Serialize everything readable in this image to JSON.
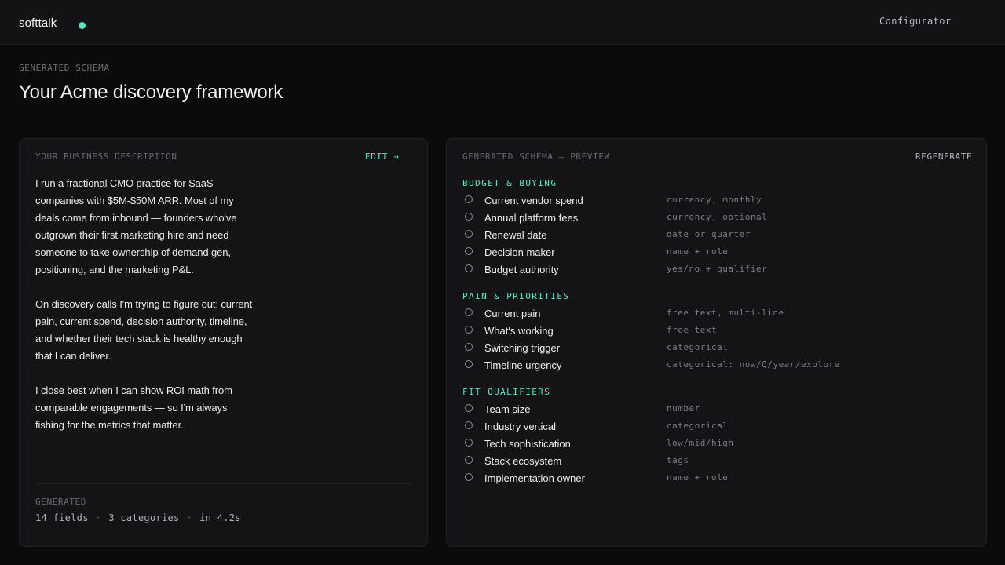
{
  "app": {
    "brand": "softtalk",
    "status_color": "#5ee0bd",
    "nav_link": "Configurator"
  },
  "header": {
    "eyebrow": "GENERATED SCHEMA",
    "title": "Your Acme discovery framework"
  },
  "left_panel": {
    "label": "YOUR BUSINESS DESCRIPTION",
    "edit_label": "EDIT →",
    "paragraphs": [
      "I run a fractional CMO practice for SaaS companies with $5M-$50M ARR. Most of my deals come from inbound — founders who've outgrown their first marketing hire and need someone to take ownership of demand gen, positioning, and the marketing P&L.",
      "On discovery calls I'm trying to figure out: current pain, current spend, decision authority, timeline, and whether their tech stack is healthy enough that I can deliver.",
      "I close best when I can show ROI math from comparable engagements — so I'm always fishing for the metrics that matter."
    ],
    "generated_label": "GENERATED",
    "stats": {
      "fields": "14 fields",
      "categories": "3 categories",
      "time": "in 4.2s",
      "separator": "·"
    }
  },
  "right_panel": {
    "label": "GENERATED SCHEMA — PREVIEW",
    "regenerate_label": "REGENERATE",
    "accent_color": "#5ee0bd",
    "categories": [
      {
        "title": "BUDGET & BUYING",
        "fields": [
          {
            "name": "Current vendor spend",
            "type": "currency, monthly"
          },
          {
            "name": "Annual platform fees",
            "type": "currency, optional"
          },
          {
            "name": "Renewal date",
            "type": "date or quarter"
          },
          {
            "name": "Decision maker",
            "type": "name + role"
          },
          {
            "name": "Budget authority",
            "type": "yes/no + qualifier"
          }
        ]
      },
      {
        "title": "PAIN & PRIORITIES",
        "fields": [
          {
            "name": "Current pain",
            "type": "free text, multi-line"
          },
          {
            "name": "What's working",
            "type": "free text"
          },
          {
            "name": "Switching trigger",
            "type": "categorical"
          },
          {
            "name": "Timeline urgency",
            "type": "categorical: now/Q/year/explore"
          }
        ]
      },
      {
        "title": "FIT QUALIFIERS",
        "fields": [
          {
            "name": "Team size",
            "type": "number"
          },
          {
            "name": "Industry vertical",
            "type": "categorical"
          },
          {
            "name": "Tech sophistication",
            "type": "low/mid/high"
          },
          {
            "name": "Stack ecosystem",
            "type": "tags"
          },
          {
            "name": "Implementation owner",
            "type": "name + role"
          }
        ]
      }
    ]
  }
}
